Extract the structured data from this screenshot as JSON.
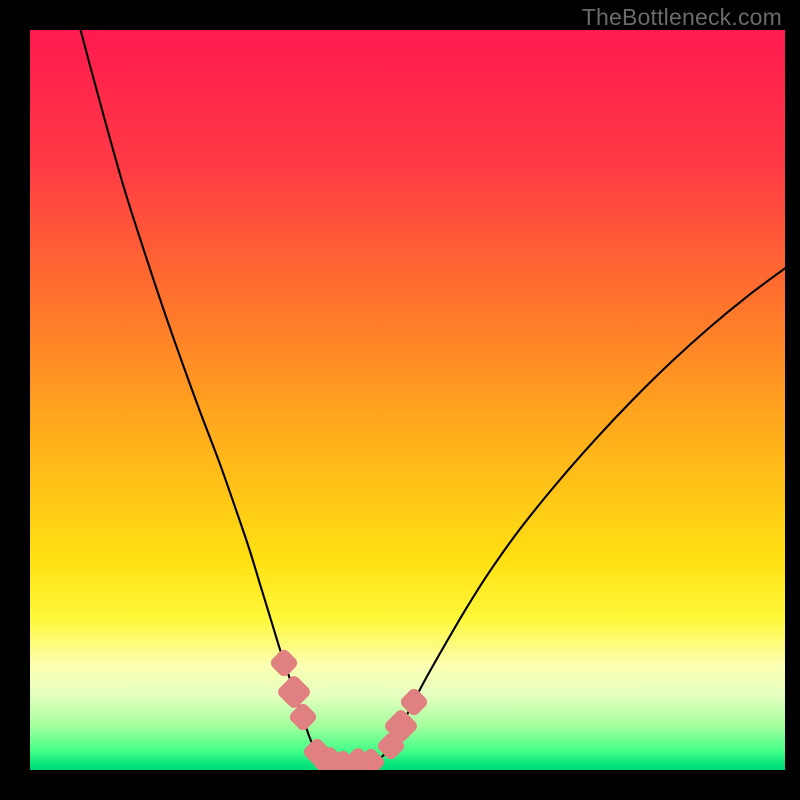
{
  "watermark": "TheBottleneck.com",
  "chart_data": {
    "type": "line",
    "title": "",
    "xlabel": "",
    "ylabel": "",
    "xlim": [
      0,
      100
    ],
    "ylim": [
      0,
      100
    ],
    "gradient_stops": [
      {
        "offset": 0,
        "color": "#ff1a4f"
      },
      {
        "offset": 0.18,
        "color": "#ff3a44"
      },
      {
        "offset": 0.38,
        "color": "#ff7a2a"
      },
      {
        "offset": 0.55,
        "color": "#ffb21a"
      },
      {
        "offset": 0.7,
        "color": "#ffe012"
      },
      {
        "offset": 0.78,
        "color": "#fff83a"
      },
      {
        "offset": 0.84,
        "color": "#fcffb0"
      },
      {
        "offset": 0.88,
        "color": "#e6ffc0"
      },
      {
        "offset": 0.92,
        "color": "#a8ff9e"
      },
      {
        "offset": 0.955,
        "color": "#44ff88"
      },
      {
        "offset": 0.975,
        "color": "#00e07a"
      },
      {
        "offset": 1.0,
        "color": "#00c86e"
      }
    ],
    "series": [
      {
        "name": "left-curve",
        "points": [
          [
            6.7,
            100.0
          ],
          [
            8.0,
            95.0
          ],
          [
            10.0,
            87.5
          ],
          [
            12.5,
            78.5
          ],
          [
            15.0,
            70.5
          ],
          [
            17.5,
            62.8
          ],
          [
            20.0,
            55.5
          ],
          [
            22.5,
            48.5
          ],
          [
            25.0,
            41.8
          ],
          [
            27.0,
            36.0
          ],
          [
            29.0,
            30.0
          ],
          [
            30.5,
            25.0
          ],
          [
            32.0,
            20.0
          ],
          [
            33.2,
            16.0
          ],
          [
            34.2,
            13.0
          ],
          [
            35.0,
            10.5
          ],
          [
            35.8,
            8.2
          ],
          [
            36.5,
            6.0
          ],
          [
            37.0,
            4.5
          ],
          [
            37.5,
            3.3
          ],
          [
            38.0,
            2.4
          ],
          [
            38.5,
            1.8
          ],
          [
            39.0,
            1.3
          ],
          [
            39.5,
            1.0
          ],
          [
            40.0,
            0.85
          ],
          [
            40.5,
            0.8
          ]
        ]
      },
      {
        "name": "bottom-curve",
        "points": [
          [
            40.5,
            0.8
          ],
          [
            41.5,
            0.78
          ],
          [
            42.5,
            0.78
          ],
          [
            43.5,
            0.8
          ],
          [
            44.5,
            0.9
          ],
          [
            45.5,
            1.1
          ]
        ]
      },
      {
        "name": "right-curve",
        "points": [
          [
            45.5,
            1.1
          ],
          [
            46.0,
            1.3
          ],
          [
            46.5,
            1.7
          ],
          [
            47.0,
            2.2
          ],
          [
            47.5,
            3.0
          ],
          [
            48.2,
            4.0
          ],
          [
            49.0,
            5.5
          ],
          [
            50.0,
            7.6
          ],
          [
            51.0,
            9.6
          ],
          [
            52.5,
            12.5
          ],
          [
            55.0,
            17.0
          ],
          [
            58.0,
            22.2
          ],
          [
            61.0,
            27.0
          ],
          [
            65.0,
            32.7
          ],
          [
            70.0,
            39.0
          ],
          [
            75.0,
            44.8
          ],
          [
            80.0,
            50.2
          ],
          [
            85.0,
            55.2
          ],
          [
            90.0,
            59.8
          ],
          [
            95.0,
            64.0
          ],
          [
            100.0,
            67.8
          ]
        ]
      }
    ],
    "markers": [
      {
        "x": 33.6,
        "y": 14.5,
        "size": "normal"
      },
      {
        "x": 35.0,
        "y": 10.5,
        "size": "big"
      },
      {
        "x": 36.1,
        "y": 7.2,
        "size": "normal"
      },
      {
        "x": 38.0,
        "y": 2.5,
        "size": "normal"
      },
      {
        "x": 39.7,
        "y": 0.9,
        "size": "big"
      },
      {
        "x": 41.5,
        "y": 0.78,
        "size": "normal"
      },
      {
        "x": 43.4,
        "y": 0.8,
        "size": "big"
      },
      {
        "x": 45.2,
        "y": 1.05,
        "size": "normal"
      },
      {
        "x": 47.8,
        "y": 3.3,
        "size": "normal"
      },
      {
        "x": 49.2,
        "y": 6.0,
        "size": "big"
      },
      {
        "x": 50.8,
        "y": 9.2,
        "size": "normal"
      }
    ]
  }
}
